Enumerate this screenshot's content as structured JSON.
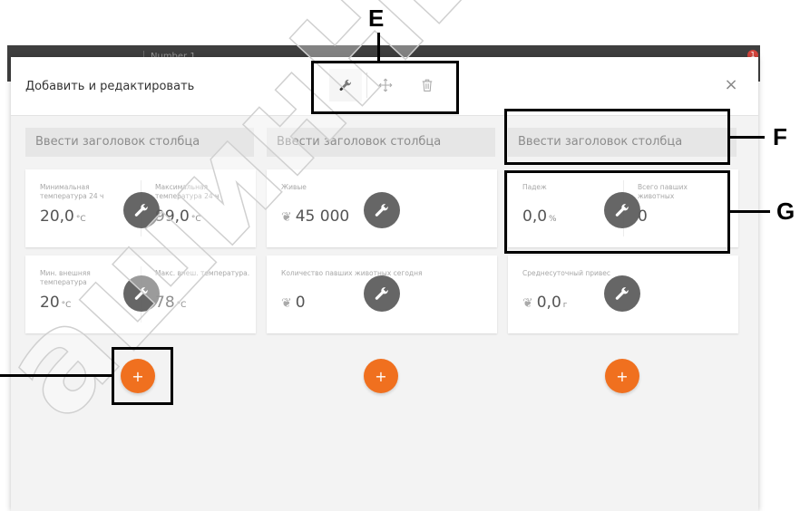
{
  "background_app": {
    "tab_label": "Number 1",
    "badge": "1"
  },
  "dialog": {
    "title": "Добавить и редактировать",
    "close_label": "×",
    "columns": [
      {
        "header": "Ввести заголовок столбца",
        "cards": [
          {
            "metrics": [
              {
                "label": "Минимальная температура 24 ч",
                "value": "20,0",
                "unit": "°C"
              },
              {
                "label": "Максимальная температура 24 ч",
                "value": "99,0",
                "unit": "°C"
              }
            ]
          },
          {
            "metrics": [
              {
                "label": "Мин. внешняя температура",
                "value": "20",
                "unit": "°C"
              },
              {
                "label": "Макс. внеш. температура.",
                "value": "78",
                "unit": "°C"
              }
            ]
          }
        ],
        "add_label": "+"
      },
      {
        "header": "Ввести заголовок столбца",
        "cards": [
          {
            "metrics": [
              {
                "label": "Живые",
                "value": "45 000",
                "unit": "",
                "icon": "chicken-icon"
              }
            ]
          },
          {
            "metrics": [
              {
                "label": "Количество павших животных сегодня",
                "value": "0",
                "unit": "",
                "icon": "chicken-icon"
              }
            ]
          }
        ],
        "add_label": "+"
      },
      {
        "header": "Ввести заголовок столбца",
        "cards": [
          {
            "metrics": [
              {
                "label": "Падеж",
                "value": "0,0",
                "unit": "%"
              },
              {
                "label": "Всего павших животных",
                "value": "0",
                "unit": ""
              }
            ]
          },
          {
            "metrics": [
              {
                "label": "Среднесуточный привес",
                "value": "0,0",
                "unit": "г",
                "icon": "chicken-icon"
              }
            ]
          }
        ],
        "add_label": "+"
      }
    ]
  },
  "callouts": {
    "E": "E",
    "F": "F",
    "G": "G"
  },
  "watermark_text": "ашинНы",
  "colors": {
    "accent": "#f0701f",
    "wrench": "#5b5b5b",
    "header_bg": "#e6e6e6",
    "dialog_bg": "#f3f3f3"
  }
}
